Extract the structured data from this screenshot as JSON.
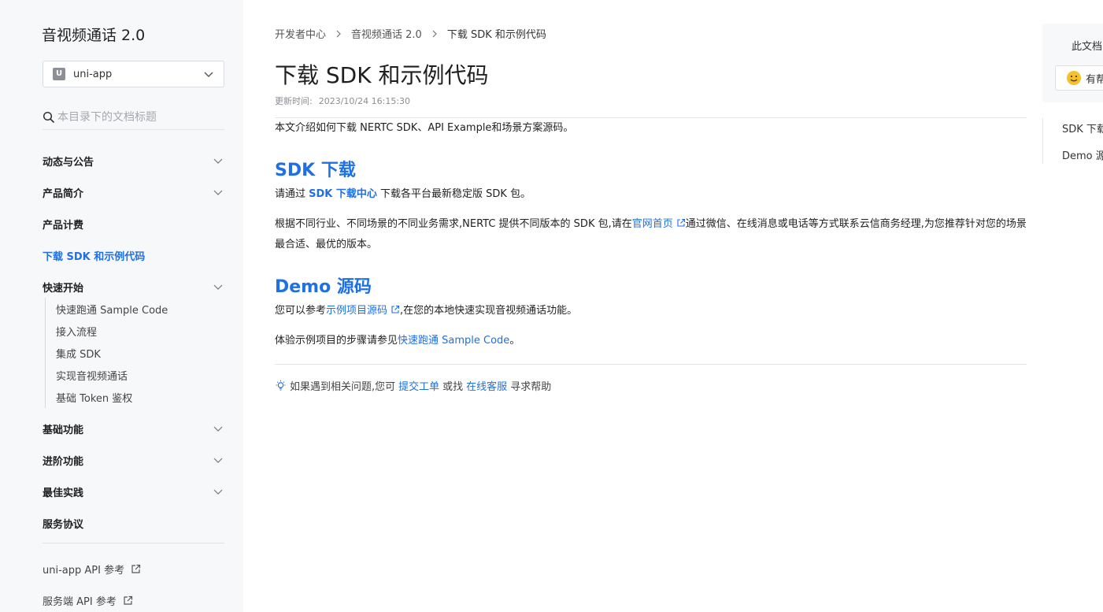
{
  "sidebar": {
    "title": "音视频通话 2.0",
    "platform_select": {
      "value": "uni-app",
      "logo": "U"
    },
    "search": {
      "placeholder": "本目录下的文档标题"
    },
    "items": [
      {
        "label": "动态与公告",
        "has_children": true
      },
      {
        "label": "产品简介",
        "has_children": true
      },
      {
        "label": "产品计费",
        "has_children": false
      },
      {
        "label": "下载 SDK 和示例代码",
        "has_children": false,
        "active": true
      },
      {
        "label": "快速开始",
        "has_children": true,
        "expanded": true,
        "children": [
          "快速跑通 Sample Code",
          "接入流程",
          "集成 SDK",
          "实现音视频通话",
          "基础 Token 鉴权"
        ]
      },
      {
        "label": "基础功能",
        "has_children": true
      },
      {
        "label": "进阶功能",
        "has_children": true
      },
      {
        "label": "最佳实践",
        "has_children": true
      },
      {
        "label": "服务协议",
        "has_children": false
      }
    ],
    "external_links": [
      "uni-app API 参考",
      "服务端 API 参考"
    ]
  },
  "breadcrumb": [
    "开发者中心",
    "音视频通话 2.0",
    "下载 SDK 和示例代码"
  ],
  "page": {
    "title": "下载 SDK 和示例代码",
    "updated_label": "更新时间:",
    "updated_time": "2023/10/24 16:15:30",
    "intro": "本文介绍如何下载 NERTC SDK、API Example和场景方案源码。",
    "sdk_section": {
      "heading": "SDK 下载",
      "p1_before": "请通过 ",
      "p1_link": "SDK 下载中心",
      "p1_after": " 下载各平台最新稳定版 SDK 包。",
      "p2_before": "根据不同行业、不同场景的不同业务需求,NERTC 提供不同版本的 SDK 包,请在",
      "p2_link": "官网首页",
      "p2_after": "通过微信、在线消息或电话等方式联系云信商务经理,为您推荐针对您的场景最合适、最优的版本。"
    },
    "demo_section": {
      "heading": "Demo 源码",
      "p1_before": "您可以参考",
      "p1_link": "示例项目源码",
      "p1_after": ",在您的本地快速实现音视频通话功能。",
      "p2_before": "体验示例项目的步骤请参见",
      "p2_link": "快速跑通 Sample Code",
      "p2_after": "。"
    },
    "help": {
      "before": "如果遇到相关问题,您可",
      "ticket_link": "提交工单",
      "middle": "或找",
      "service_link": "在线客服",
      "after": "寻求帮助"
    }
  },
  "feedback": {
    "question": "此文档",
    "button": "有帮"
  },
  "toc": [
    "SDK 下载",
    "Demo 源码"
  ],
  "colors": {
    "accent": "#1f6fe5",
    "sidebar_bg": "#f7f8fa"
  }
}
